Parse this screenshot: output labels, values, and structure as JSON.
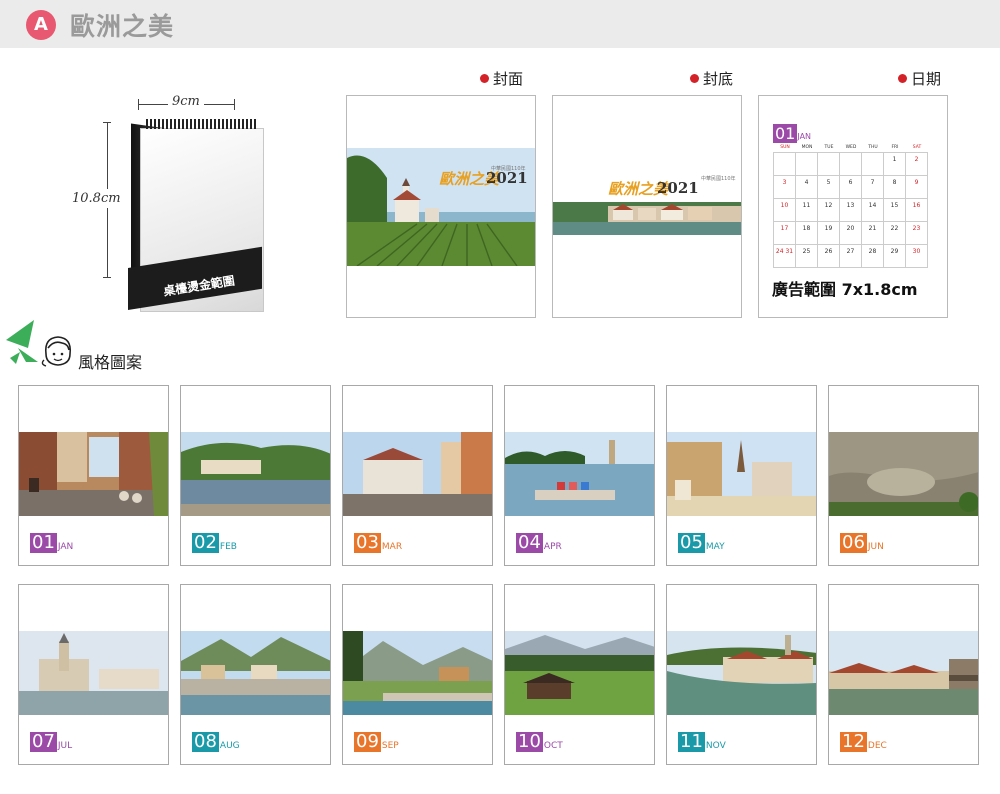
{
  "header": {
    "badge": "A",
    "title": "歐洲之美"
  },
  "product": {
    "width_label": "9cm",
    "height_label": "10.8cm",
    "base_text": "桌檯燙金範圍"
  },
  "previews": {
    "cover_label": "封面",
    "back_label": "封底",
    "date_label": "日期",
    "cover_title": "歐洲之美",
    "cover_year": "2021",
    "cover_sub": "中華民國110年",
    "back_title": "歐洲之美",
    "back_year": "2021",
    "back_sub": "中華民國110年"
  },
  "date_page": {
    "month_num": "01",
    "month_name": "JAN",
    "weekdays": [
      "SUN",
      "MON",
      "TUE",
      "WED",
      "THU",
      "FRI",
      "SAT"
    ],
    "days": [
      "",
      "",
      "",
      "",
      "",
      "1",
      "2",
      "3",
      "4",
      "5",
      "6",
      "7",
      "8",
      "9",
      "10",
      "11",
      "12",
      "13",
      "14",
      "15",
      "16",
      "17",
      "18",
      "19",
      "20",
      "21",
      "22",
      "23",
      "24 31",
      "25",
      "26",
      "27",
      "28",
      "29",
      "30"
    ],
    "ad_text": "廣告範圍 7x1.8cm"
  },
  "style_section": {
    "title": "風格圖案"
  },
  "months": [
    {
      "num": "01",
      "name": "JAN",
      "color": "#9b4aa8",
      "scene": "street"
    },
    {
      "num": "02",
      "name": "FEB",
      "color": "#1a9aa8",
      "scene": "river"
    },
    {
      "num": "03",
      "name": "MAR",
      "color": "#e8752a",
      "scene": "square"
    },
    {
      "num": "04",
      "name": "APR",
      "color": "#9b4aa8",
      "scene": "lake"
    },
    {
      "num": "05",
      "name": "MAY",
      "color": "#1a9aa8",
      "scene": "church"
    },
    {
      "num": "06",
      "name": "JUN",
      "color": "#e8752a",
      "scene": "rock"
    },
    {
      "num": "07",
      "name": "JUL",
      "color": "#9b4aa8",
      "scene": "cathedral"
    },
    {
      "num": "08",
      "name": "AUG",
      "color": "#1a9aa8",
      "scene": "alps"
    },
    {
      "num": "09",
      "name": "SEP",
      "color": "#e8752a",
      "scene": "valley"
    },
    {
      "num": "10",
      "name": "OCT",
      "color": "#9b4aa8",
      "scene": "meadow"
    },
    {
      "num": "11",
      "name": "NOV",
      "color": "#1a9aa8",
      "scene": "town"
    },
    {
      "num": "12",
      "name": "DEC",
      "color": "#e8752a",
      "scene": "bridge"
    }
  ]
}
